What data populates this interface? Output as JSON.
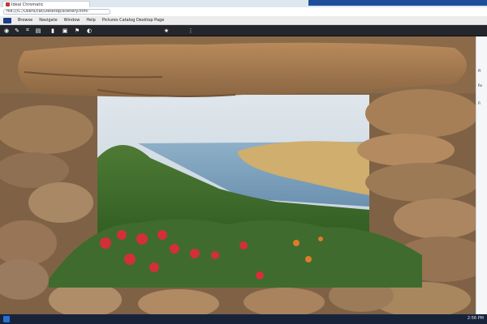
{
  "browser": {
    "tab_title": "Ideal Chromatic",
    "address": "file:///C:/Users/cat/Desktop/scenery.html"
  },
  "menubar": {
    "items": [
      "Browse",
      "Navigate",
      "Window",
      "Help",
      "Pictures Catalog Desktop Page"
    ]
  },
  "toolbar": {
    "buttons": [
      {
        "name": "app-logo-icon",
        "color": "#2a73d8",
        "glyph": "◉"
      },
      {
        "name": "pen-icon",
        "color": "#3b3f46",
        "glyph": "✎"
      },
      {
        "name": "crop-icon",
        "color": "#3b3f46",
        "glyph": "⌗"
      },
      {
        "name": "layers-icon",
        "color": "#3b3f46",
        "glyph": "▤"
      },
      {
        "name": "folder-icon",
        "color": "#e47b2b",
        "glyph": "▮"
      },
      {
        "name": "image-icon",
        "color": "#6c8bb6",
        "glyph": "▣"
      },
      {
        "name": "flag-icon",
        "color": "#c33a3a",
        "glyph": "⚑"
      },
      {
        "name": "palette-icon",
        "color": "#3b3f46",
        "glyph": "◐"
      },
      {
        "name": "star-icon",
        "color": "#e6b23a",
        "glyph": "★"
      },
      {
        "name": "grid-icon",
        "color": "#3b3f46",
        "glyph": "⋮"
      }
    ]
  },
  "side_panel": {
    "items": [
      "Pl",
      "Re",
      "Fi"
    ]
  },
  "taskbar": {
    "tray_text": "2:56 PM"
  },
  "colors": {
    "sky": "#cdd8e0",
    "sea": "#7a9fbd",
    "sand": "#d3b679",
    "stone": "#a07a54",
    "flowers": "#d32f3a",
    "foliage": "#3f6b2e"
  }
}
